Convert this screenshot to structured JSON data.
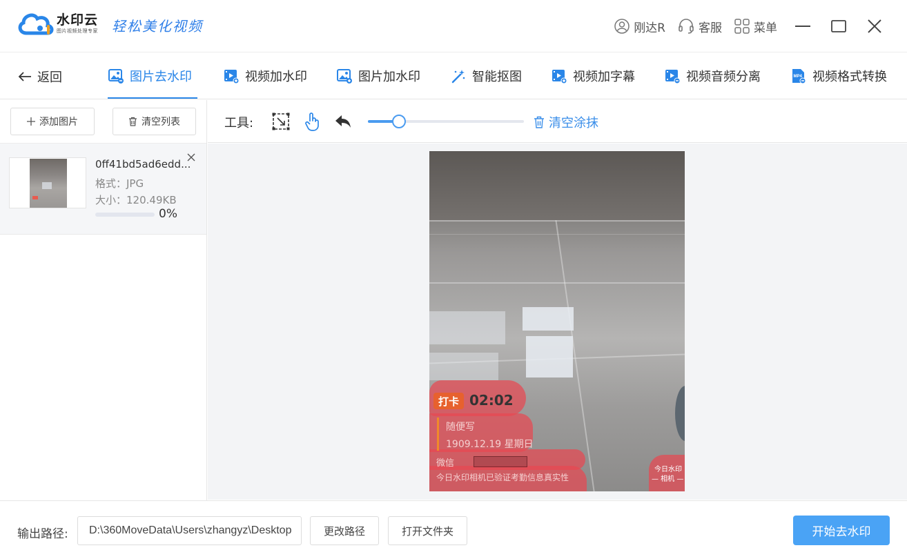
{
  "app": {
    "name": "水印云",
    "subtitle": "图片视频处理专家",
    "slogan": "轻松美化视频",
    "user": "刚达R",
    "service": "客服",
    "menu": "菜单"
  },
  "tabs": {
    "back": "返回",
    "items": [
      {
        "label": "图片去水印",
        "active": true
      },
      {
        "label": "视频加水印"
      },
      {
        "label": "图片加水印"
      },
      {
        "label": "智能抠图"
      },
      {
        "label": "视频加字幕"
      },
      {
        "label": "视频音频分离"
      },
      {
        "label": "视频格式转换"
      }
    ]
  },
  "left": {
    "add_label": "添加图片",
    "clear_label": "清空列表",
    "file": {
      "name": "0ff41bd5ad6edd...",
      "format": "格式：JPG",
      "size": "大小：120.49KB",
      "progress": 0,
      "progress_text": "0%"
    }
  },
  "toolbar": {
    "label": "工具:",
    "brush_level": 0.2,
    "clear_label": "清空涂抹"
  },
  "watermark": {
    "badge": "打卡",
    "time": "02:02",
    "note": "随便写",
    "date": "1909.12.19 星期日",
    "wechat": "微信",
    "verify": "今日水印相机已验证考勤信息真实性",
    "corner_line1": "今日水印",
    "corner_line2": "— 相机 —"
  },
  "bottom": {
    "output_label": "输出路径:",
    "output_path": "D:\\360MoveData\\Users\\zhangyz\\Desktop",
    "change_path": "更改路径",
    "open_folder": "打开文件夹",
    "start": "开始去水印"
  },
  "colors": {
    "accent": "#2a86e8",
    "start_button": "#4aa3f5",
    "mask": "#e84852"
  }
}
